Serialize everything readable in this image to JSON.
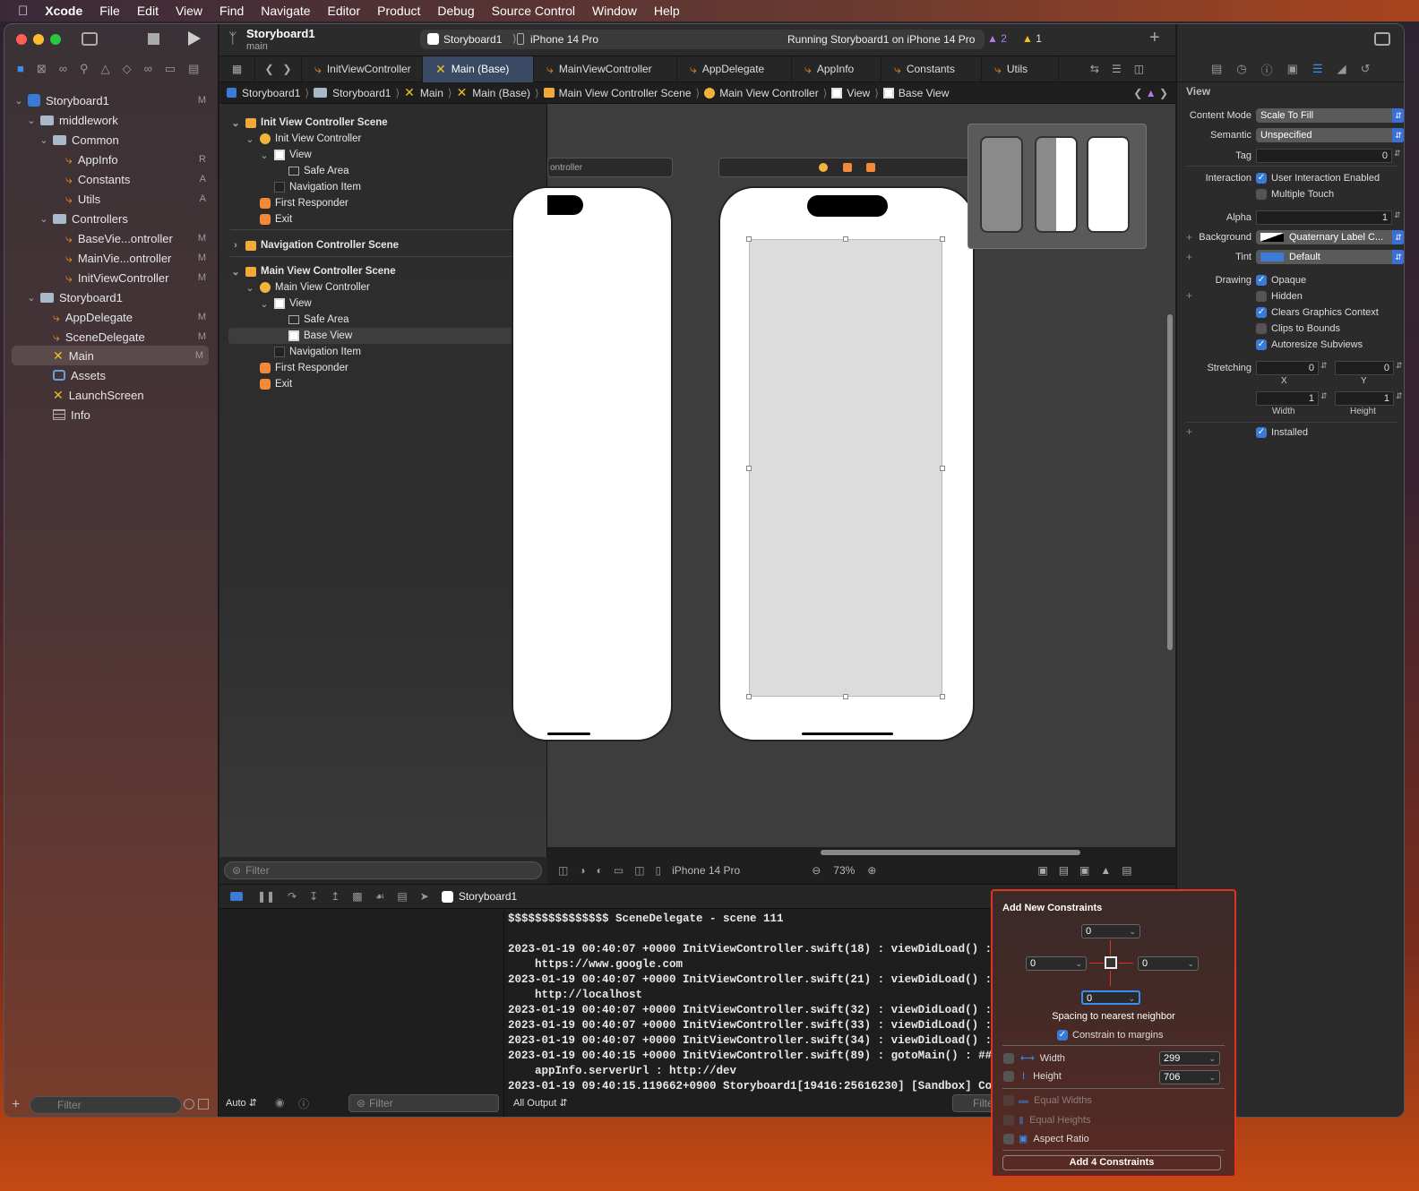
{
  "menubar": {
    "app": "Xcode",
    "items": [
      "File",
      "Edit",
      "View",
      "Find",
      "Navigate",
      "Editor",
      "Product",
      "Debug",
      "Source Control",
      "Window",
      "Help"
    ]
  },
  "toolbar": {
    "project": "Storyboard1",
    "branch": "main",
    "scheme": "Storyboard1",
    "device": "iPhone 14 Pro",
    "status": "Running Storyboard1 on iPhone 14 Pro",
    "warnings": "2",
    "issues": "1"
  },
  "navigator": {
    "items": [
      {
        "label": "Storyboard1",
        "badge": "M",
        "kind": "project"
      },
      {
        "label": "middlework",
        "badge": "",
        "kind": "folder"
      },
      {
        "label": "Common",
        "badge": "",
        "kind": "folder"
      },
      {
        "label": "AppInfo",
        "badge": "R",
        "kind": "swift"
      },
      {
        "label": "Constants",
        "badge": "A",
        "kind": "swift"
      },
      {
        "label": "Utils",
        "badge": "A",
        "kind": "swift"
      },
      {
        "label": "Controllers",
        "badge": "",
        "kind": "folder"
      },
      {
        "label": "BaseVie...ontroller",
        "badge": "M",
        "kind": "swift"
      },
      {
        "label": "MainVie...ontroller",
        "badge": "M",
        "kind": "swift"
      },
      {
        "label": "InitViewController",
        "badge": "M",
        "kind": "swift"
      },
      {
        "label": "Storyboard1",
        "badge": "",
        "kind": "folder"
      },
      {
        "label": "AppDelegate",
        "badge": "M",
        "kind": "swift"
      },
      {
        "label": "SceneDelegate",
        "badge": "M",
        "kind": "swift"
      },
      {
        "label": "Main",
        "badge": "M",
        "kind": "storyboard"
      },
      {
        "label": "Assets",
        "badge": "",
        "kind": "assets"
      },
      {
        "label": "LaunchScreen",
        "badge": "",
        "kind": "storyboard"
      },
      {
        "label": "Info",
        "badge": "",
        "kind": "plist"
      }
    ],
    "filter_placeholder": "Filter"
  },
  "tabs": [
    "InitViewController",
    "Main (Base)",
    "MainViewController",
    "AppDelegate",
    "AppInfo",
    "Constants",
    "Utils"
  ],
  "jumpbar": [
    "Storyboard1",
    "Storyboard1",
    "Main",
    "Main (Base)",
    "Main View Controller Scene",
    "Main View Controller",
    "View",
    "Base View"
  ],
  "outline": {
    "items": [
      "Init View Controller Scene",
      "Init View Controller",
      "View",
      "Safe Area",
      "Navigation Item",
      "First Responder",
      "Exit",
      "Navigation Controller Scene",
      "Main View Controller Scene",
      "Main View Controller",
      "View",
      "Safe Area",
      "Base View",
      "Navigation Item",
      "First Responder",
      "Exit"
    ],
    "filter_placeholder": "Filter"
  },
  "canvas": {
    "scene_title": "ontroller",
    "device": "iPhone 14 Pro",
    "zoom": "73%"
  },
  "debug": {
    "target": "Storyboard1",
    "auto": "Auto",
    "filter_placeholder": "Filter",
    "output": "All Output",
    "console_lines": [
      "$$$$$$$$$$$$$$$ SceneDelegate - scene 111",
      "",
      "2023-01-19 00:40:07 +0000 InitViewController.swift(18) : viewDidLoad() : a",
      "    https://www.google.com",
      "2023-01-19 00:40:07 +0000 InitViewController.swift(21) : viewDidLoad() : a",
      "    http://localhost",
      "2023-01-19 00:40:07 +0000 InitViewController.swift(32) : viewDidLoad() : U",
      "2023-01-19 00:40:07 +0000 InitViewController.swift(33) : viewDidLoad() : S",
      "2023-01-19 00:40:07 +0000 InitViewController.swift(34) : viewDidLoad() : U",
      "2023-01-19 00:40:15 +0000 InitViewController.swift(89) : gotoMain() : ###",
      "    appInfo.serverUrl : http://dev",
      "2023-01-19 09:40:15.119662+0900 Storyboard1[19416:25616230] [Sandbox] Coul"
    ]
  },
  "inspector": {
    "section": "View",
    "content_mode_label": "Content Mode",
    "content_mode": "Scale To Fill",
    "semantic_label": "Semantic",
    "semantic": "Unspecified",
    "tag_label": "Tag",
    "tag": "0",
    "interaction_label": "Interaction",
    "user_interaction": "User Interaction Enabled",
    "multiple_touch": "Multiple Touch",
    "alpha_label": "Alpha",
    "alpha": "1",
    "background_label": "Background",
    "background": "Quaternary Label C...",
    "tint_label": "Tint",
    "tint": "Default",
    "drawing_label": "Drawing",
    "opaque": "Opaque",
    "hidden": "Hidden",
    "clears": "Clears Graphics Context",
    "clips": "Clips to Bounds",
    "autoresize": "Autoresize Subviews",
    "stretching_label": "Stretching",
    "stretch_x": "0",
    "stretch_y": "0",
    "x_label": "X",
    "y_label": "Y",
    "stretch_w": "1",
    "stretch_h": "1",
    "width_label": "Width",
    "height_label": "Height",
    "installed": "Installed"
  },
  "popover": {
    "title": "Add New Constraints",
    "top": "0",
    "left": "0",
    "right": "0",
    "bottom": "0",
    "spacing_label": "Spacing to nearest neighbor",
    "constrain_margins": "Constrain to margins",
    "width_label": "Width",
    "width": "299",
    "height_label": "Height",
    "height": "706",
    "equal_widths": "Equal Widths",
    "equal_heights": "Equal Heights",
    "aspect_ratio": "Aspect Ratio",
    "add_button": "Add 4 Constraints"
  },
  "colors": {
    "accent": "#3a7bd8",
    "swift": "#f08a24",
    "highlight": "#e0341e"
  }
}
